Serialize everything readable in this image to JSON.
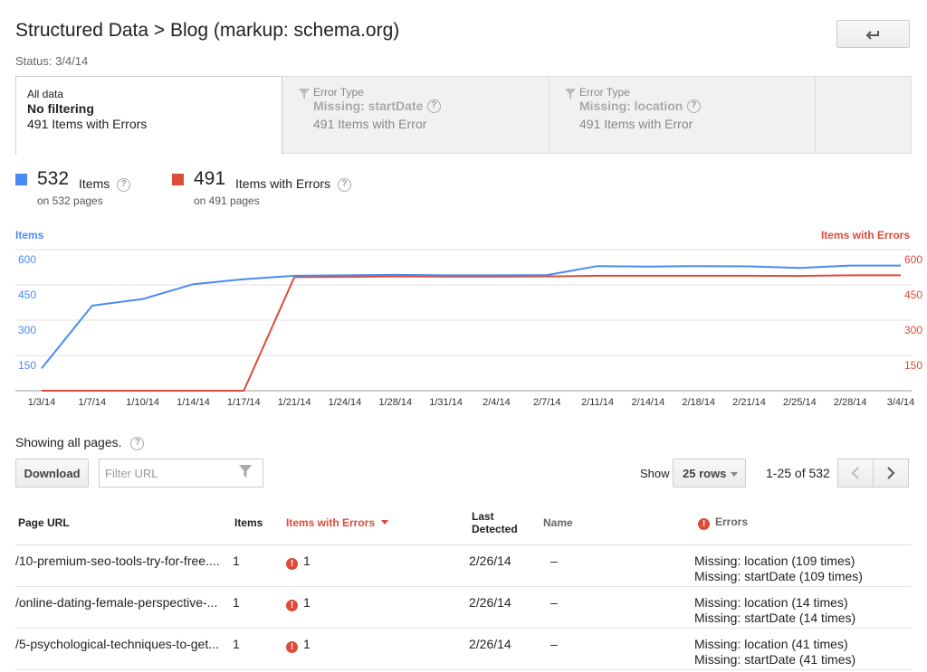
{
  "header": {
    "title": "Structured Data > Blog (markup: schema.org)",
    "status": "Status: 3/4/14",
    "back_icon": "back-arrow-icon"
  },
  "filter_tabs": [
    {
      "label_small": "All data",
      "label_bold": "No filtering",
      "count": "491 Items with Errors",
      "active": true
    },
    {
      "label_small": "Error Type",
      "label_bold": "Missing: startDate",
      "count": "491 Items with Error",
      "active": false
    },
    {
      "label_small": "Error Type",
      "label_bold": "Missing: location",
      "count": "491 Items with Error",
      "active": false
    }
  ],
  "metrics": {
    "items": {
      "value": "532",
      "label": "Items",
      "sub": "on 532 pages",
      "color": "#4a8af4"
    },
    "errors": {
      "value": "491",
      "label": "Items with Errors",
      "sub": "on 491 pages",
      "color": "#dd4b39"
    },
    "help_glyph": "?"
  },
  "chart_data": {
    "type": "line",
    "left_axis_title": "Items",
    "right_axis_title": "Items with Errors",
    "y_ticks": [
      "600",
      "450",
      "300",
      "150"
    ],
    "ylim": [
      0,
      600
    ],
    "x_labels": [
      "1/3/14",
      "1/7/14",
      "1/10/14",
      "1/14/14",
      "1/17/14",
      "1/21/14",
      "1/24/14",
      "1/28/14",
      "1/31/14",
      "2/4/14",
      "2/7/14",
      "2/11/14",
      "2/14/14",
      "2/18/14",
      "2/21/14",
      "2/25/14",
      "2/28/14",
      "3/4/14"
    ],
    "series": [
      {
        "name": "Items",
        "color": "#4a8af4",
        "values": [
          95,
          362,
          390,
          453,
          474,
          489,
          491,
          493,
          491,
          491,
          492,
          530,
          528,
          530,
          529,
          522,
          532,
          532
        ]
      },
      {
        "name": "Items with Errors",
        "color": "#dd4b39",
        "values": [
          0,
          0,
          0,
          0,
          0,
          483,
          484,
          486,
          485,
          485,
          486,
          489,
          489,
          489,
          489,
          488,
          491,
          491
        ]
      }
    ]
  },
  "table_controls": {
    "showing": "Showing all pages.",
    "download_label": "Download",
    "filter_placeholder": "Filter URL",
    "show_label": "Show",
    "rows_value": "25 rows",
    "pager_text": "1-25 of 532"
  },
  "table": {
    "headers": {
      "url": "Page URL",
      "items": "Items",
      "errors": "Items with Errors",
      "last_detected_1": "Last",
      "last_detected_2": "Detected",
      "name": "Name",
      "error_col": "Errors"
    },
    "rows": [
      {
        "url": "/10-premium-seo-tools-try-for-free....",
        "items": "1",
        "errors": "1",
        "date": "2/26/14",
        "name": "–",
        "err1": "Missing: location (109 times)",
        "err2": "Missing: startDate (109 times)"
      },
      {
        "url": "/online-dating-female-perspective-...",
        "items": "1",
        "errors": "1",
        "date": "2/26/14",
        "name": "–",
        "err1": "Missing: location (14 times)",
        "err2": "Missing: startDate (14 times)"
      },
      {
        "url": "/5-psychological-techniques-to-get...",
        "items": "1",
        "errors": "1",
        "date": "2/26/14",
        "name": "–",
        "err1": "Missing: location (41 times)",
        "err2": "Missing: startDate (41 times)"
      }
    ],
    "error_glyph": "!"
  }
}
